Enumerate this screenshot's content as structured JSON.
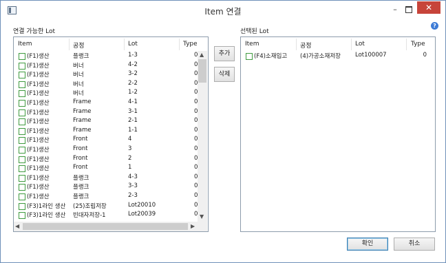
{
  "window": {
    "title": "Item 연결",
    "minimize": "–",
    "close": "✕",
    "help": "?"
  },
  "left_panel": {
    "label": "연결 가능한 Lot",
    "columns": [
      "Item",
      "공정",
      "Lot",
      "Type"
    ],
    "rows": [
      [
        "(F1)생산",
        "플랭크",
        "1-3",
        "0"
      ],
      [
        "(F1)생산",
        "버너",
        "4-2",
        "0"
      ],
      [
        "(F1)생산",
        "버너",
        "3-2",
        "0"
      ],
      [
        "(F1)생산",
        "버너",
        "2-2",
        "0"
      ],
      [
        "(F1)생산",
        "버너",
        "1-2",
        "0"
      ],
      [
        "(F1)생산",
        "Frame",
        "4-1",
        "0"
      ],
      [
        "(F1)생산",
        "Frame",
        "3-1",
        "0"
      ],
      [
        "(F1)생산",
        "Frame",
        "2-1",
        "0"
      ],
      [
        "(F1)생산",
        "Frame",
        "1-1",
        "0"
      ],
      [
        "(F1)생산",
        "Front",
        "4",
        "0"
      ],
      [
        "(F1)생산",
        "Front",
        "3",
        "0"
      ],
      [
        "(F1)생산",
        "Front",
        "2",
        "0"
      ],
      [
        "(F1)생산",
        "Front",
        "1",
        "0"
      ],
      [
        "(F1)생산",
        "플랭크",
        "4-3",
        "0"
      ],
      [
        "(F1)생산",
        "플랭크",
        "3-3",
        "0"
      ],
      [
        "(F1)생산",
        "플랭크",
        "2-3",
        "0"
      ],
      [
        "(F3)1라인 생산",
        "(25)조립저장",
        "Lot20010",
        "0"
      ],
      [
        "(F3)1라인 생산",
        "빈대자저장-1",
        "Lot20039",
        "0"
      ]
    ]
  },
  "right_panel": {
    "label": "선택된 Lot",
    "columns": [
      "Item",
      "공정",
      "Lot",
      "Type"
    ],
    "rows": [
      [
        "(F4)소재입고",
        "(4)가공소재저장",
        "Lot100007",
        "0"
      ]
    ]
  },
  "buttons": {
    "add": "추가",
    "delete": "삭제",
    "ok": "확인",
    "cancel": "취소"
  },
  "scroll": {
    "up": "▲",
    "down": "▼",
    "left": "◀",
    "right": "▶"
  },
  "colors": {
    "checkbox_border": "#3e9a3e",
    "close_button": "#c7443a",
    "help_icon": "#3d7bd6"
  }
}
